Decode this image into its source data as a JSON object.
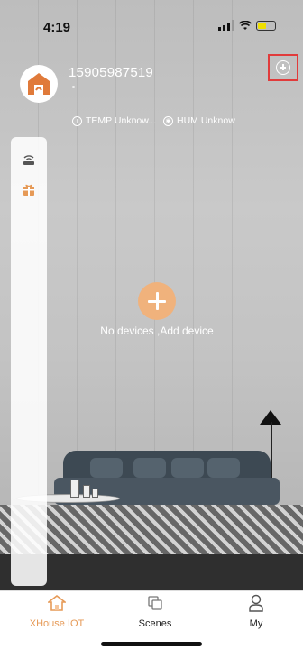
{
  "status_bar": {
    "time": "4:19"
  },
  "header": {
    "phone": "15905987519",
    "temp_label": "TEMP Unknow...",
    "hum_label": "HUM Unknow"
  },
  "empty_state": {
    "message": "No devices ,Add device"
  },
  "tabs": [
    {
      "label": "XHouse IOT",
      "icon": "home-icon",
      "active": true
    },
    {
      "label": "Scenes",
      "icon": "scenes-icon",
      "active": false
    },
    {
      "label": "My",
      "icon": "user-icon",
      "active": false
    }
  ],
  "colors": {
    "accent": "#e69a57",
    "plus_bg": "#f0b27c",
    "highlight_box": "#e13b3b"
  },
  "side_panel": {
    "items": [
      {
        "icon": "router-icon"
      },
      {
        "icon": "gift-icon"
      }
    ]
  }
}
